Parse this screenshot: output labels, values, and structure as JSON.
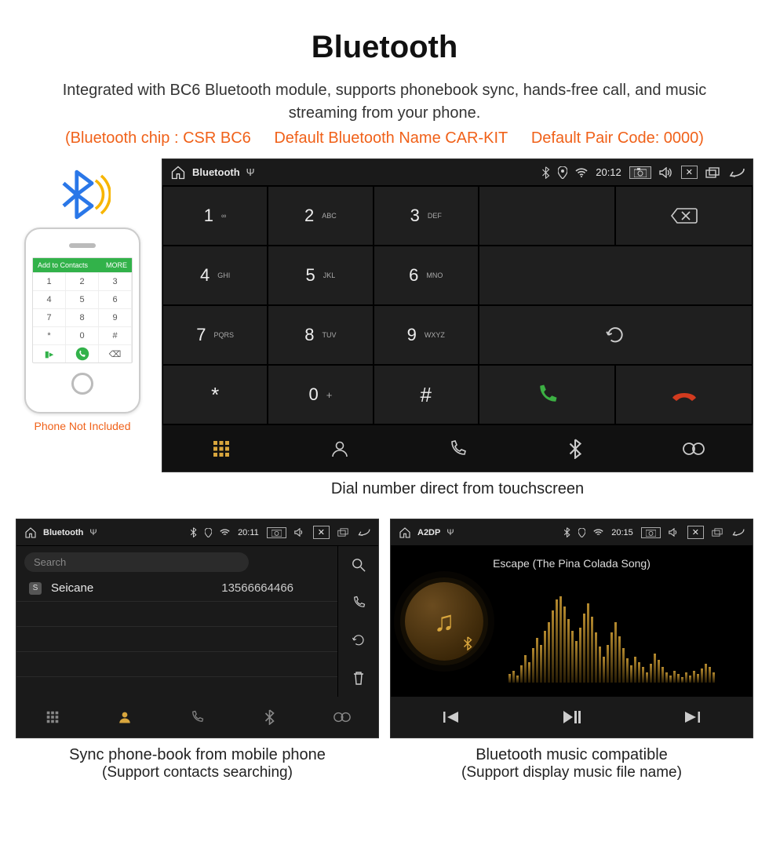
{
  "title": "Bluetooth",
  "subtitle": "Integrated with BC6 Bluetooth module, supports phonebook sync, hands-free call, and music streaming from your phone.",
  "specs": {
    "chip": "(Bluetooth chip : CSR BC6",
    "name": "Default Bluetooth Name CAR-KIT",
    "pair": "Default Pair Code: 0000)"
  },
  "phone_note": "Phone Not Included",
  "handset": {
    "bar_left": "Add to Contacts",
    "bar_right": "MORE",
    "keys": [
      "1",
      "2",
      "3",
      "4",
      "5",
      "6",
      "7",
      "8",
      "9",
      "*",
      "0",
      "#"
    ]
  },
  "dialer": {
    "status": {
      "title": "Bluetooth",
      "time": "20:12"
    },
    "keys": [
      {
        "n": "1",
        "s": "∞"
      },
      {
        "n": "2",
        "s": "ABC"
      },
      {
        "n": "3",
        "s": "DEF"
      },
      {
        "n": "4",
        "s": "GHI"
      },
      {
        "n": "5",
        "s": "JKL"
      },
      {
        "n": "6",
        "s": "MNO"
      },
      {
        "n": "7",
        "s": "PQRS"
      },
      {
        "n": "8",
        "s": "TUV"
      },
      {
        "n": "9",
        "s": "WXYZ"
      },
      {
        "n": "*",
        "s": ""
      },
      {
        "n": "0",
        "s": "+"
      },
      {
        "n": "#",
        "s": ""
      }
    ],
    "caption": "Dial number direct from touchscreen"
  },
  "phonebook": {
    "status": {
      "title": "Bluetooth",
      "time": "20:11"
    },
    "search_placeholder": "Search",
    "contact": {
      "badge": "S",
      "name": "Seicane",
      "phone": "13566664466"
    },
    "caption_line1": "Sync phone-book from mobile phone",
    "caption_line2": "(Support contacts searching)"
  },
  "a2dp": {
    "status": {
      "title": "A2DP",
      "time": "20:15"
    },
    "song": "Escape (The Pina Colada Song)",
    "caption_line1": "Bluetooth music compatible",
    "caption_line2": "(Support display music file name)"
  }
}
